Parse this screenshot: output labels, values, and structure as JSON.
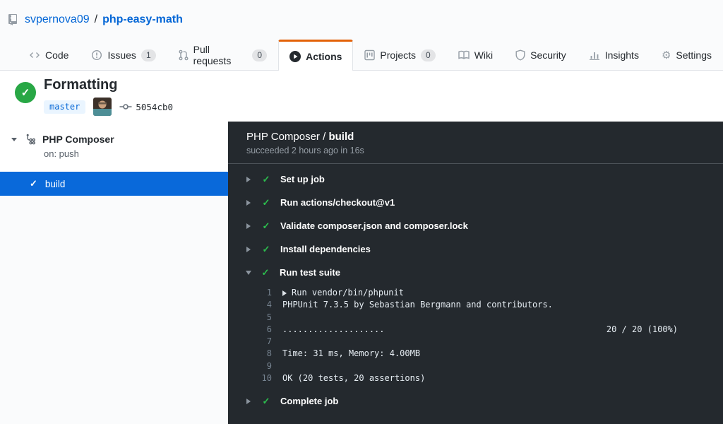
{
  "breadcrumb": {
    "owner": "svpernova09",
    "separator": "/",
    "repo": "php-easy-math"
  },
  "tabs": [
    {
      "label": "Code",
      "icon": "code-icon"
    },
    {
      "label": "Issues",
      "count": "1",
      "icon": "issue-icon"
    },
    {
      "label": "Pull requests",
      "count": "0",
      "icon": "pull-request-icon"
    },
    {
      "label": "Actions",
      "icon": "play-icon",
      "active": true
    },
    {
      "label": "Projects",
      "count": "0",
      "icon": "project-icon"
    },
    {
      "label": "Wiki",
      "icon": "book-icon"
    },
    {
      "label": "Security",
      "icon": "shield-icon"
    },
    {
      "label": "Insights",
      "icon": "graph-icon"
    },
    {
      "label": "Settings",
      "icon": "gear-icon"
    }
  ],
  "run_header": {
    "title": "Formatting",
    "status": "success",
    "status_icon": "check-icon",
    "branch": "master",
    "commit": "5054cb0"
  },
  "sidebar": {
    "workflow": {
      "name": "PHP Composer",
      "trigger": "on: push",
      "icon": "workflow-icon"
    },
    "jobs": [
      {
        "name": "build",
        "status": "success",
        "selected": true
      }
    ]
  },
  "panel": {
    "header": {
      "workflow": "PHP Composer",
      "separator": " / ",
      "job": "build",
      "subtitle": "succeeded 2 hours ago in 16s"
    },
    "steps": [
      {
        "name": "Set up job",
        "status": "success",
        "expanded": false
      },
      {
        "name": "Run actions/checkout@v1",
        "status": "success",
        "expanded": false
      },
      {
        "name": "Validate composer.json and composer.lock",
        "status": "success",
        "expanded": false
      },
      {
        "name": "Install dependencies",
        "status": "success",
        "expanded": false
      },
      {
        "name": "Run test suite",
        "status": "success",
        "expanded": true
      },
      {
        "name": "Complete job",
        "status": "success",
        "expanded": false
      }
    ],
    "log": {
      "lines": [
        {
          "num": "1",
          "text": "Run vendor/bin/phpunit",
          "expander": true
        },
        {
          "num": "4",
          "text": "PHPUnit 7.3.5 by Sebastian Bergmann and contributors."
        },
        {
          "num": "5",
          "text": ""
        },
        {
          "num": "6",
          "text": "....................",
          "right": "20 / 20 (100%)"
        },
        {
          "num": "7",
          "text": ""
        },
        {
          "num": "8",
          "text": "Time: 31 ms, Memory: 4.00MB"
        },
        {
          "num": "9",
          "text": ""
        },
        {
          "num": "10",
          "text": "OK (20 tests, 20 assertions)"
        }
      ]
    }
  },
  "colors": {
    "link_blue": "#0366d6",
    "selected_job_blue": "#0969da",
    "active_tab_orange": "#e36209",
    "success_green": "#28a745",
    "success_green_on_dark": "#2cbe4e",
    "panel_dark": "#24292e",
    "page_light": "#fafbfc",
    "border": "#e1e4e8",
    "branch_badge_bg": "#eaf5ff"
  }
}
